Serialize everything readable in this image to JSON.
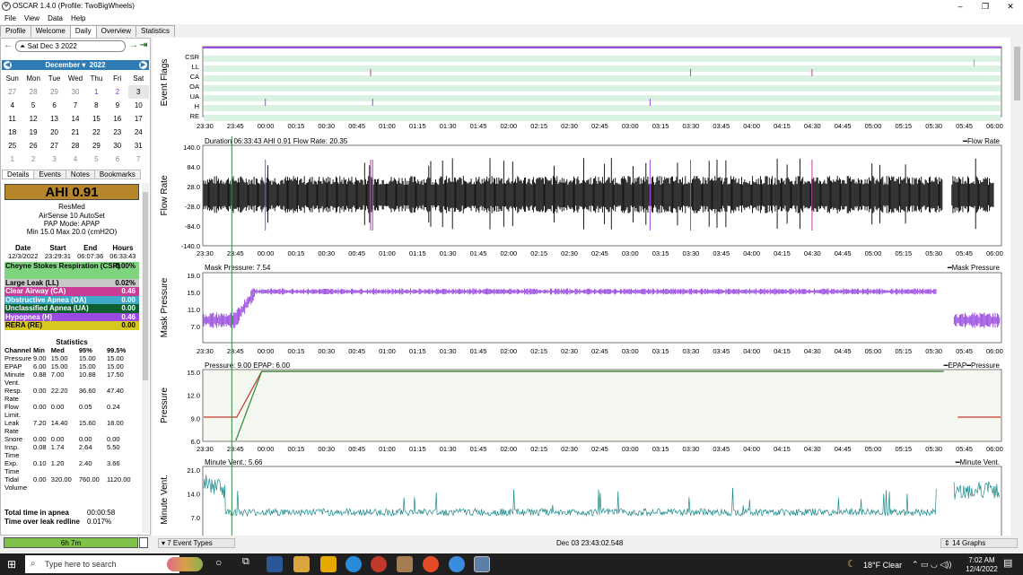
{
  "window": {
    "title": "OSCAR 1.4.0 (Profile: TwoBigWheels)",
    "min": "–",
    "restore": "❐",
    "close": "✕"
  },
  "menu": [
    "File",
    "View",
    "Data",
    "Help"
  ],
  "tabs": [
    "Profile",
    "Welcome",
    "Daily",
    "Overview",
    "Statistics"
  ],
  "date_selector": "Sat Dec 3 2022",
  "calendar": {
    "month": "December",
    "year": "2022",
    "weekdays": [
      "Sun",
      "Mon",
      "Tue",
      "Wed",
      "Thu",
      "Fri",
      "Sat"
    ],
    "weeks": [
      [
        "27",
        "28",
        "29",
        "30",
        "1",
        "2",
        "3"
      ],
      [
        "4",
        "5",
        "6",
        "7",
        "8",
        "9",
        "10"
      ],
      [
        "11",
        "12",
        "13",
        "14",
        "15",
        "16",
        "17"
      ],
      [
        "18",
        "19",
        "20",
        "21",
        "22",
        "23",
        "24"
      ],
      [
        "25",
        "26",
        "27",
        "28",
        "29",
        "30",
        "31"
      ],
      [
        "1",
        "2",
        "3",
        "4",
        "5",
        "6",
        "7"
      ]
    ]
  },
  "subtabs": [
    "Details",
    "Events",
    "Notes",
    "Bookmarks"
  ],
  "details": {
    "ahi": "AHI 0.91",
    "brand": "ResMed",
    "model": "AirSense 10 AutoSet",
    "mode": "PAP Mode: APAP",
    "range": "Min 15.0 Max 20.0 (cmH2O)",
    "session_headers": [
      "Date",
      "Start",
      "End",
      "Hours"
    ],
    "session": [
      "12/3/2022",
      "23:29:31",
      "06:07:36",
      "06:33:43"
    ]
  },
  "events": [
    {
      "label": "Cheyne Stokes Respiration (CSR)",
      "value": "0.00%",
      "color": "#7fd47f"
    },
    {
      "label": "Large Leak (LL)",
      "value": "0.02%",
      "color": "#c8c8c8"
    },
    {
      "label": "Clear Airway (CA)",
      "value": "0.46",
      "color": "#c83c96"
    },
    {
      "label": "Obstructive Apnea (OA)",
      "value": "0.00",
      "color": "#3fa9c9"
    },
    {
      "label": "Unclassified Apnea (UA)",
      "value": "0.00",
      "color": "#0c5f2f"
    },
    {
      "label": "Hypopnea (H)",
      "value": "0.46",
      "color": "#9a4ae0"
    },
    {
      "label": "RERA (RE)",
      "value": "0.00",
      "color": "#d6c81e"
    }
  ],
  "statistics": {
    "title": "Statistics",
    "headers": [
      "Channel",
      "Min",
      "Med",
      "95%",
      "99.5%"
    ],
    "rows": [
      [
        "Pressure",
        "9.00",
        "15.00",
        "15.00",
        "15.00"
      ],
      [
        "EPAP",
        "6.00",
        "15.00",
        "15.00",
        "15.00"
      ],
      [
        "Minute Vent.",
        "0.88",
        "7.00",
        "10.88",
        "17.50"
      ],
      [
        "Resp. Rate",
        "0.00",
        "22.20",
        "36.60",
        "47.40"
      ],
      [
        "Flow Limit.",
        "0.00",
        "0.00",
        "0.05",
        "0.24"
      ],
      [
        "Leak Rate",
        "7.20",
        "14.40",
        "15.60",
        "18.00"
      ],
      [
        "Snore",
        "0.00",
        "0.00",
        "0.00",
        "0.00"
      ],
      [
        "Insp. Time",
        "0.08",
        "1.74",
        "2.64",
        "5.50"
      ],
      [
        "Exp. Time",
        "0.10",
        "1.20",
        "2.40",
        "3.66"
      ],
      [
        "Tidal Volume",
        "0.00",
        "320.00",
        "760.00",
        "1120.00"
      ]
    ]
  },
  "totals": [
    {
      "label": "Total time in apnea",
      "value": "00:00:58"
    },
    {
      "label": "Time over leak redline",
      "value": "0.017%"
    }
  ],
  "progress": "6h 7m",
  "time_ticks": [
    "23:30",
    "23:45",
    "00:00",
    "00:15",
    "00:30",
    "00:45",
    "01:00",
    "01:15",
    "01:30",
    "01:45",
    "02:00",
    "02:15",
    "02:30",
    "02:45",
    "03:00",
    "03:15",
    "03:30",
    "03:45",
    "04:00",
    "04:15",
    "04:30",
    "04:45",
    "05:00",
    "05:15",
    "05:30",
    "05:45",
    "06:00"
  ],
  "event_flags": {
    "ylabel": "Event Flags",
    "labels": [
      "CSR",
      "LL",
      "CA",
      "OA",
      "UA",
      "H",
      "RE"
    ],
    "ca": [
      "00:52",
      "03:30",
      "04:30"
    ],
    "h": [
      "00:00",
      "00:53",
      "03:10"
    ],
    "ll": [
      "05:50"
    ]
  },
  "flow": {
    "ylabel": "Flow Rate",
    "info": "Duration 06:33:43 AHI 0.91 Flow Rate: 20.35",
    "legend": "Flow Rate",
    "ticks": [
      "140.0",
      "84.0",
      "28.0",
      "-28.0",
      "-84.0",
      "-140.0"
    ]
  },
  "mask": {
    "ylabel": "Mask Pressure",
    "info": "Mask Pressure: 7.54",
    "legend": "Mask Pressure",
    "ticks": [
      "19.0",
      "15.0",
      "11.0",
      "7.0"
    ]
  },
  "pressure": {
    "ylabel": "Pressure",
    "info": "Pressure: 9.00 EPAP: 6.00",
    "legend_epap": "EPAP",
    "legend_pres": "Pressure",
    "ticks": [
      "15.0",
      "12.0",
      "9.0",
      "6.0"
    ]
  },
  "minvent": {
    "ylabel": "Minute Vent.",
    "info": "Minute Vent.: 5.66",
    "legend": "Minute Vent.",
    "ticks": [
      "21.0",
      "14.0",
      "7.0"
    ]
  },
  "bottom": {
    "event_types": "7 Event Types",
    "cursor_time": "Dec 03 23:43:02.548",
    "graphs": "14 Graphs"
  },
  "taskbar": {
    "search": "Type here to search",
    "weather": "18°F  Clear",
    "time": "7:02 AM",
    "date": "12/4/2022"
  }
}
